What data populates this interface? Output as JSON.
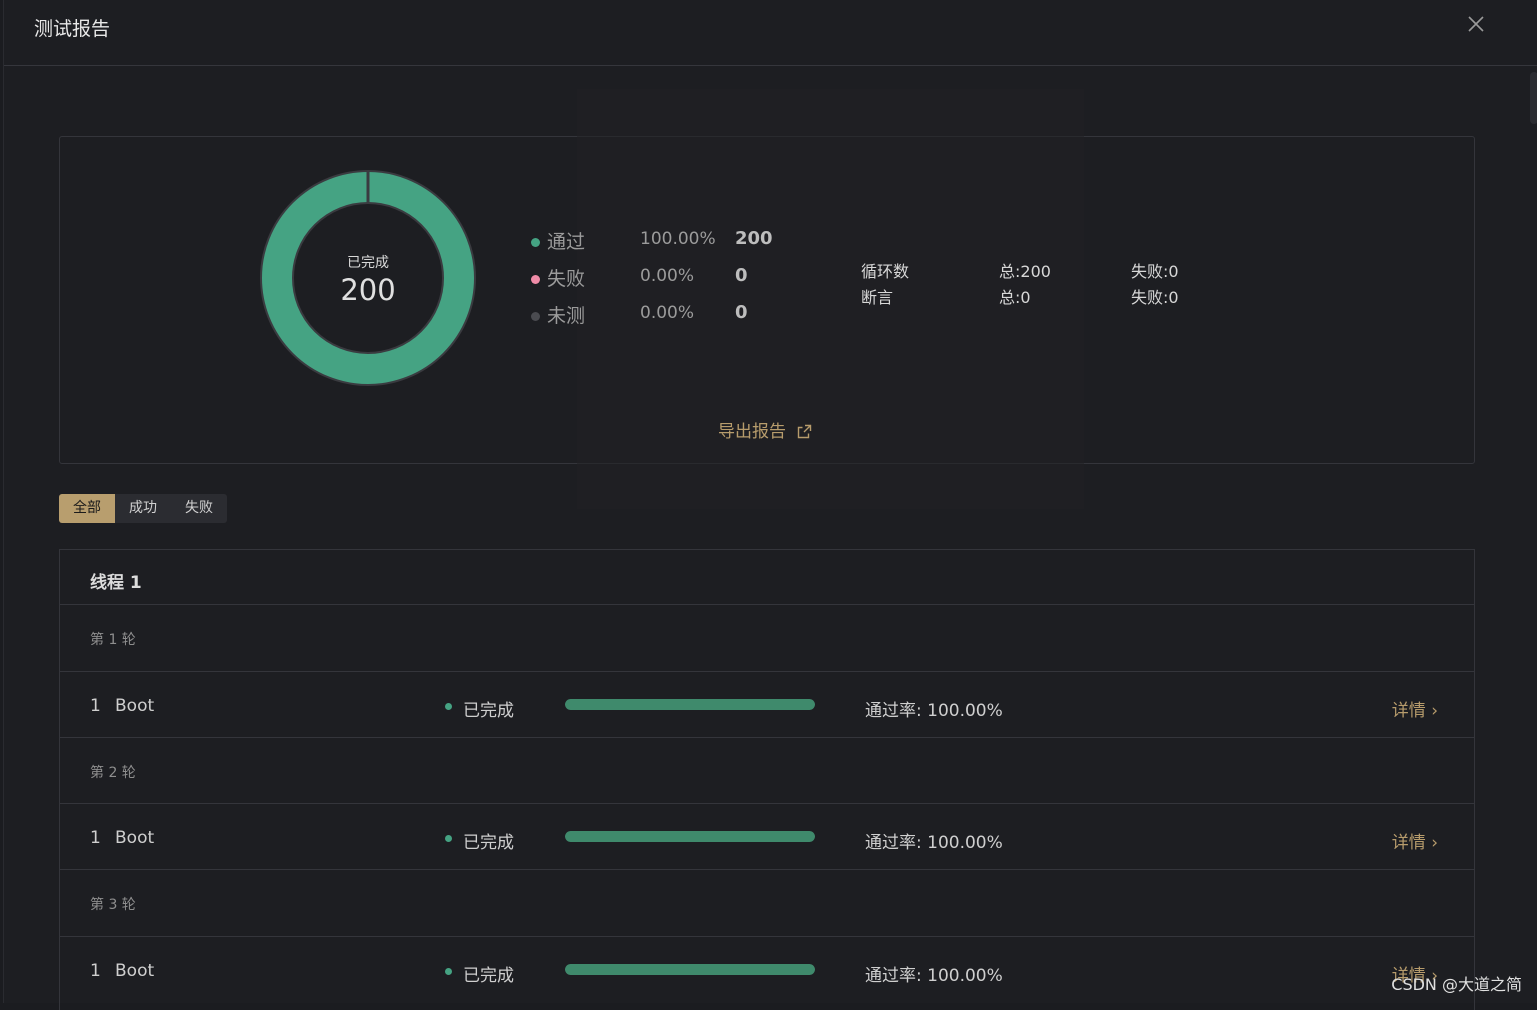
{
  "dialog": {
    "title": "测试报告"
  },
  "summary": {
    "donut": {
      "label": "已完成",
      "total": "200"
    },
    "legend": [
      {
        "label": "通过",
        "percent": "100.00%",
        "count": "200"
      },
      {
        "label": "失败",
        "percent": "0.00%",
        "count": "0"
      },
      {
        "label": "未测",
        "percent": "0.00%",
        "count": "0"
      }
    ],
    "stats": {
      "loops": {
        "label": "循环数",
        "total": "总:200",
        "fail": "失败:0"
      },
      "assertions": {
        "label": "断言",
        "total": "总:0",
        "fail": "失败:0"
      }
    },
    "export_label": "导出报告"
  },
  "filters": [
    {
      "label": "全部",
      "active": true
    },
    {
      "label": "成功"
    },
    {
      "label": "失败"
    }
  ],
  "thread": {
    "title": "线程 1",
    "rounds": [
      {
        "label": "第 1 轮",
        "item": {
          "index": "1",
          "name": "Boot",
          "status": "已完成",
          "progress": 1.0,
          "rate": "通过率: 100.00%",
          "details": "详情"
        }
      },
      {
        "label": "第 2 轮",
        "item": {
          "index": "1",
          "name": "Boot",
          "status": "已完成",
          "progress": 1.0,
          "rate": "通过率: 100.00%",
          "details": "详情"
        }
      },
      {
        "label": "第 3 轮",
        "item": {
          "index": "1",
          "name": "Boot",
          "status": "已完成",
          "progress": 1.0,
          "rate": "通过率: 100.00%",
          "details": "详情"
        }
      }
    ]
  },
  "colors": {
    "pass": "#45a383",
    "fail": "#f08ca8",
    "untested": "#4a4b50",
    "accent": "#b79c6c",
    "progress": "#3f8a6c"
  },
  "watermark": "CSDN @大道之简"
}
